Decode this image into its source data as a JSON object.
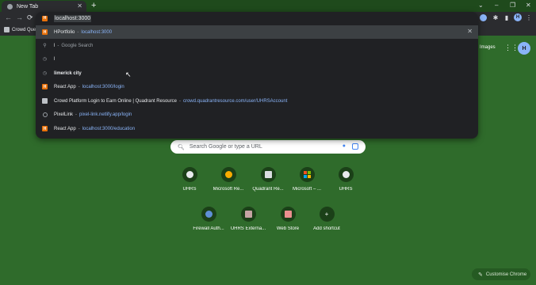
{
  "tab": {
    "title": "New Tab",
    "close": "✕",
    "new_tab": "+"
  },
  "window_controls": {
    "dropdown": "⌄",
    "minimize": "–",
    "maximize": "❐",
    "close": "✕"
  },
  "toolbar": {
    "back": "←",
    "forward": "→",
    "reload": "⟳",
    "profile_initial": "H"
  },
  "bookmarks": [
    {
      "label": "Crowd Quer"
    }
  ],
  "omnibox": {
    "input_value": "localhost:3000",
    "suggestions": [
      {
        "icon": "html-file-icon",
        "title": "HPortfolio",
        "url": "localhost:3000",
        "highlighted": true
      },
      {
        "icon": "search-icon",
        "title": "l",
        "detail": "Google Search"
      },
      {
        "icon": "history-icon",
        "title": "l"
      },
      {
        "icon": "history-icon",
        "title": "limerick city"
      },
      {
        "icon": "html-file-icon",
        "title": "React App",
        "url": "localhost:3000/login"
      },
      {
        "icon": "document-icon",
        "title": "Crowd Platform Login to Earn Online | Quadrant Resource",
        "url": "crowd.quadrantresource.com/user/UHRSAccount"
      },
      {
        "icon": "globe-icon",
        "title": "PixelLink",
        "url": "pixel-link.netlify.app/login"
      },
      {
        "icon": "html-file-icon",
        "title": "React App",
        "url": "localhost:3000/education"
      }
    ]
  },
  "page": {
    "images_link": "Images",
    "avatar_initial": "H",
    "search_placeholder": "Search Google or type a URL",
    "shortcuts": [
      {
        "label": "UHRS"
      },
      {
        "label": "Microsoft Re..."
      },
      {
        "label": "Quadrant Re..."
      },
      {
        "label": "Microsoft – ..."
      },
      {
        "label": "UHRS"
      },
      {
        "label": "Firewall Auth..."
      },
      {
        "label": "UHRS Externa..."
      },
      {
        "label": "Web Store"
      },
      {
        "label": "Add shortcut"
      }
    ],
    "customise_label": "Customise Chrome"
  },
  "colors": {
    "page_bg": "#2f6b2b",
    "popup_bg": "#202124",
    "link": "#8ab4f8"
  }
}
